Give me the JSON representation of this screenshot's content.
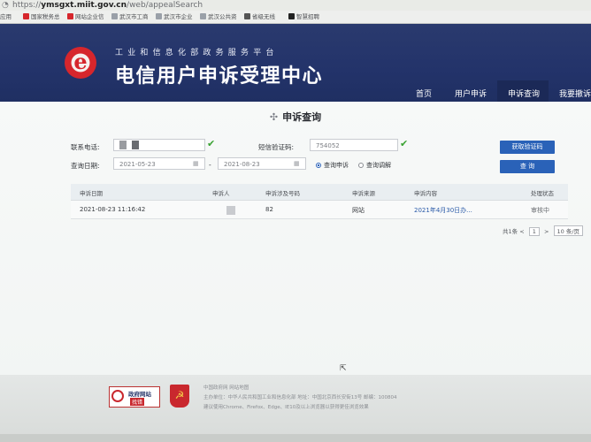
{
  "browser": {
    "url_prefix": "https://",
    "url_host": "ymsgxt.miit.gov.cn",
    "url_path": "/web/appealSearch",
    "bookmarks": [
      {
        "label": "应用",
        "color": "#6b8bd6"
      },
      {
        "label": "国家税务总",
        "color": "#d6262c"
      },
      {
        "label": "网站企业信",
        "color": "#d6262c"
      },
      {
        "label": "武汉市工商",
        "color": "#9aa0a8"
      },
      {
        "label": "武汉市企业",
        "color": "#9aa0a8"
      },
      {
        "label": "武汉公共资",
        "color": "#9aa0a8"
      },
      {
        "label": "省级无线",
        "color": "#555"
      },
      {
        "label": "智慧招聘",
        "color": "#222"
      }
    ]
  },
  "header": {
    "logo_letter": "e",
    "subtitle": "工业和信息化部政务服务平台",
    "title": "电信用户申诉受理中心",
    "nav": [
      {
        "label": "首页"
      },
      {
        "label": "用户申诉"
      },
      {
        "label": "申诉查询",
        "active": true
      },
      {
        "label": "我要撤诉"
      }
    ]
  },
  "page": {
    "heading_icon": "✣",
    "heading": "申诉查询"
  },
  "form": {
    "phone_label": "联系电话:",
    "phone_value": "",
    "code_label": "短信验证码:",
    "code_value": "754052",
    "get_code_button": "获取验证码",
    "date_label": "查询日期:",
    "date_from": "2021-05-23",
    "date_sep": "-",
    "date_to": "2021-08-23",
    "radio_appeal": "查询申诉",
    "radio_mediation": "查询调解",
    "search_button": "查 询"
  },
  "table": {
    "headers": [
      "申诉日期",
      "申诉人",
      "申诉涉及号码",
      "申诉来源",
      "申诉内容",
      "处理状态"
    ],
    "rows": [
      {
        "date": "2021-08-23 11:16:42",
        "person": "",
        "number": "82",
        "source": "网站",
        "content": "2021年4月30日办...",
        "status": "审核中"
      }
    ]
  },
  "pagination": {
    "total": "共1条",
    "prev": "<",
    "page": "1",
    "next": ">",
    "per_page": "10 条/页"
  },
  "footer": {
    "gov_badge_title": "政府网站",
    "gov_badge_tag": "找错",
    "line1": "中国政府网   网站地图",
    "line2": "主办单位：中华人民共和国工业和信息化部   地址：中国北京西长安街13号   邮编：100804",
    "line3": "建议使用Chrome、Firefox、Edge、IE10及以上浏览器以获得更佳浏览效果"
  },
  "colors": {
    "banner": "#23336a",
    "accent_blue": "#2a62b8",
    "check_green": "#3aa233",
    "logo_red": "#d6262c"
  }
}
